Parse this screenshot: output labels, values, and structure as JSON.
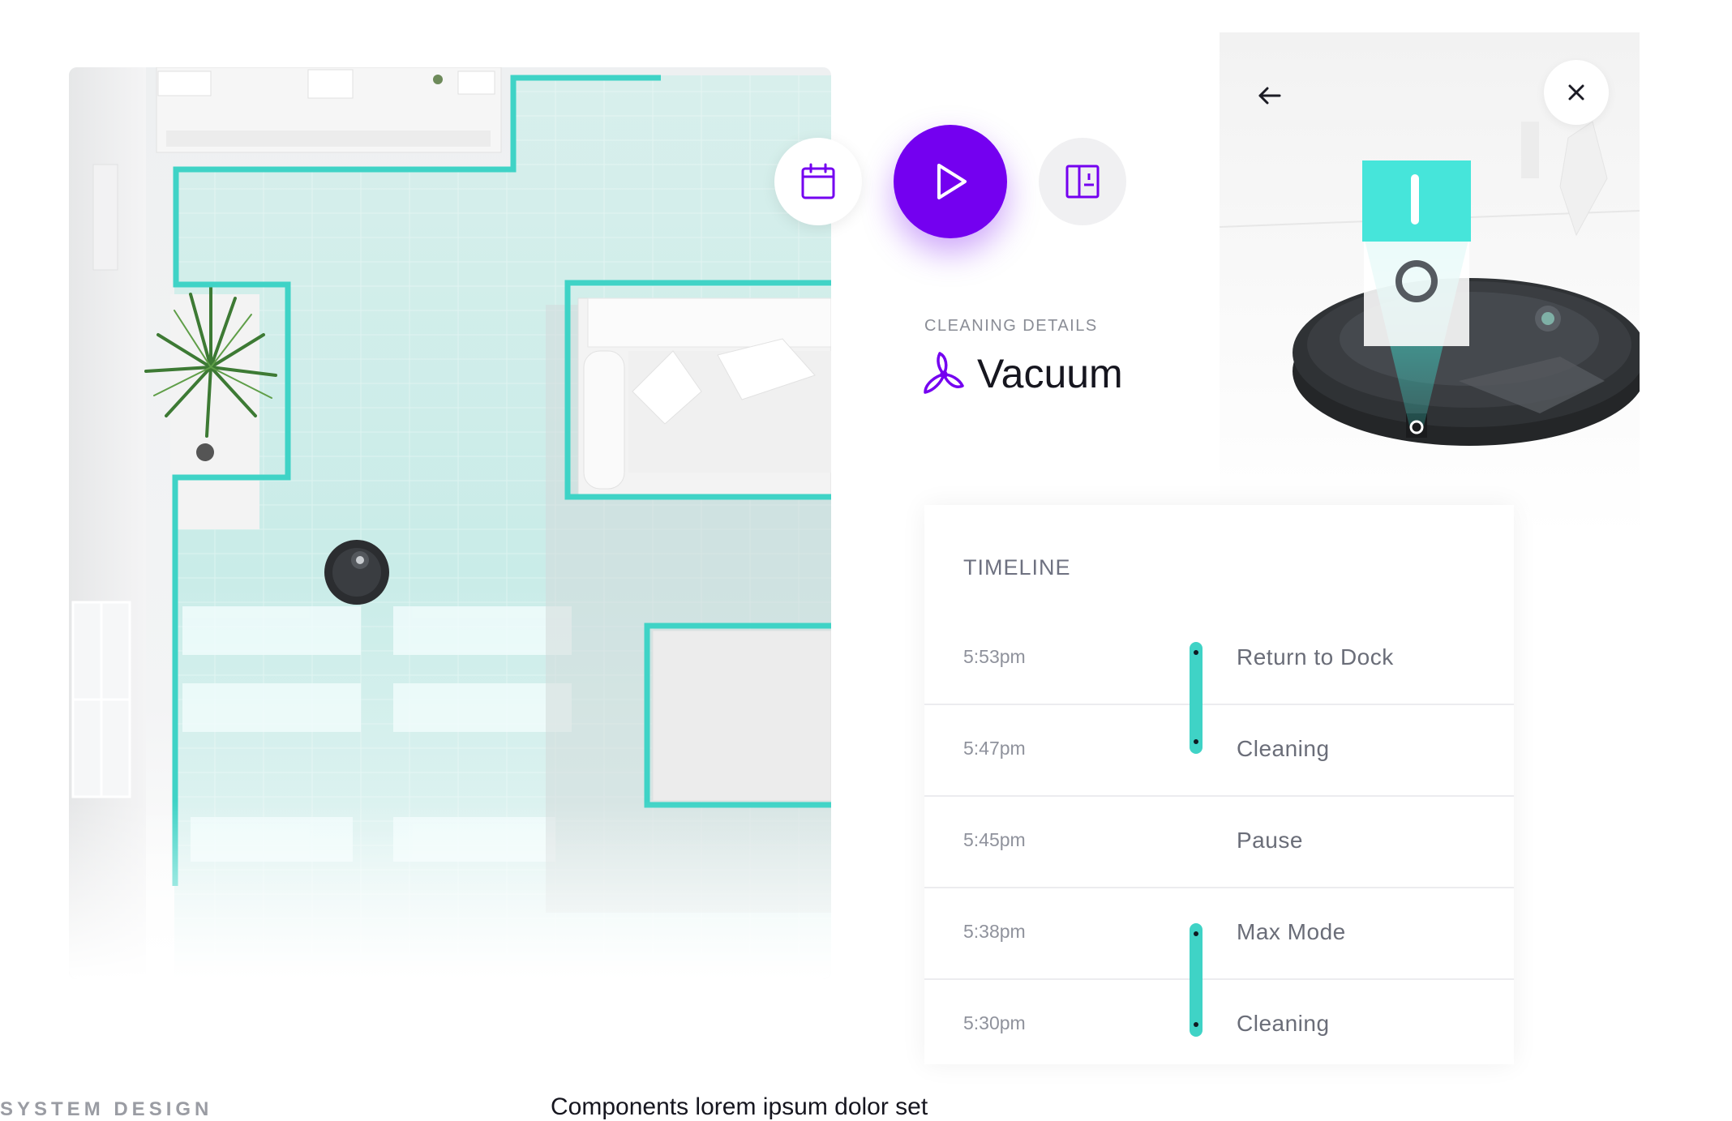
{
  "colors": {
    "accent": "#7400f0",
    "path": "#3fd3c6",
    "floor_tint": "#cdeeea"
  },
  "actions": {
    "schedule_icon": "calendar-icon",
    "start_icon": "play-icon",
    "map_icon": "floor-plan-icon"
  },
  "details": {
    "label": "CLEANING DETAILS",
    "mode_icon": "fan-icon",
    "mode": "Vacuum"
  },
  "robot_panel": {
    "back_icon": "arrow-left-icon",
    "close_icon": "close-icon"
  },
  "timeline": {
    "title": "TIMELINE",
    "rows": [
      {
        "time": "5:53pm",
        "event": "Return to Dock"
      },
      {
        "time": "5:47pm",
        "event": "Cleaning"
      },
      {
        "time": "5:45pm",
        "event": "Pause"
      },
      {
        "time": "5:38pm",
        "event": "Max Mode"
      },
      {
        "time": "5:30pm",
        "event": "Cleaning"
      }
    ]
  },
  "footer": {
    "section": "SYSTEM DESIGN",
    "caption": "Components lorem ipsum dolor set"
  }
}
